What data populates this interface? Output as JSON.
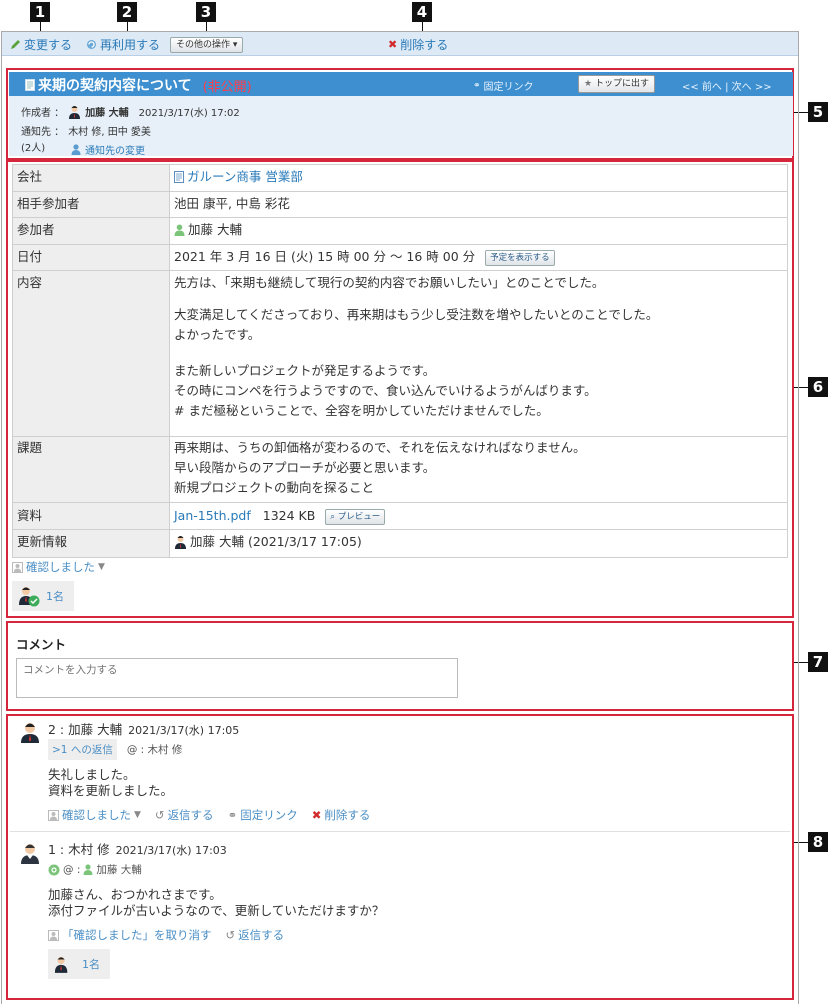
{
  "callouts": [
    "1",
    "2",
    "3",
    "4",
    "5",
    "6",
    "7",
    "8"
  ],
  "toolbar": {
    "edit": "変更する",
    "reuse": "再利用する",
    "more_ops": "その他の操作",
    "delete": "削除する"
  },
  "header": {
    "title": "来期の契約内容について",
    "visibility": "(非公開)",
    "permalink": "固定リンク",
    "pin_top": "トップに出す",
    "pager": "<< 前へ | 次へ >>"
  },
  "meta": {
    "author_label": "作成者 ：",
    "author_name": "加藤 大輔",
    "author_ts": "2021/3/17(水) 17:02",
    "notify_label": "通知先 ：",
    "notify_names": "木村 修, 田中 愛美",
    "notify_count": "(2人)",
    "notify_change": "通知先の変更"
  },
  "details": {
    "company_label": "会社",
    "company_value": "ガルーン商事 営業部",
    "counterpart_label": "相手参加者",
    "counterpart_value": "池田 康平, 中島 彩花",
    "participants_label": "参加者",
    "participants_value": "加藤 大輔",
    "date_label": "日付",
    "date_value": "2021 年 3 月 16 日 (火) 15 時 00 分 ～ 16 時 00 分",
    "show_schedule": "予定を表示する",
    "content_label": "内容",
    "content_lines": [
      "先方は、「来期も継続して現行の契約内容でお願いしたい」とのことでした。",
      "",
      "大変満足してくださっており、再来期はもう少し受注数を増やしたいとのことでした。",
      "よかったです。",
      "",
      "また新しいプロジェクトが発足するようです。",
      "その時にコンペを行うようですので、食い込んでいけるようがんばります。",
      "# まだ極秘ということで、全容を明かしていただけませんでした。"
    ],
    "issues_label": "課題",
    "issues_lines": [
      "再来期は、うちの卸価格が変わるので、それを伝えなければなりません。",
      "早い段階からのアプローチが必要と思います。",
      "新規プロジェクトの動向を探ること"
    ],
    "attach_label": "資料",
    "attach_file": "Jan-15th.pdf",
    "attach_size": "1324 KB",
    "preview": "プレビュー",
    "update_label": "更新情報",
    "update_value": "加藤 大輔 (2021/3/17 17:05)"
  },
  "confirm": {
    "label": "確認しました",
    "count": "1名"
  },
  "comment": {
    "heading": "コメント",
    "placeholder": "コメントを入力する"
  },
  "comments": [
    {
      "head": "2 : 加藤 大輔",
      "ts": "2021/3/17(水) 17:05",
      "reply_to": ">1 への返信",
      "mention": "@ : 木村 修",
      "lines": [
        "失礼しました。",
        "資料を更新しました。"
      ],
      "act_confirm": "確認しました",
      "act_reply": "返信する",
      "act_permalink": "固定リンク",
      "act_delete": "削除する"
    },
    {
      "head": "1 : 木村 修",
      "ts": "2021/3/17(水) 17:03",
      "mention_prefix": "@ :",
      "mention_name": "加藤 大輔",
      "lines": [
        "加藤さん、おつかれさまです。",
        "添付ファイルが古いようなので、更新していただけますか？"
      ],
      "act_undo": "「確認しました」を取り消す",
      "act_reply": "返信する",
      "count": "1名"
    }
  ]
}
